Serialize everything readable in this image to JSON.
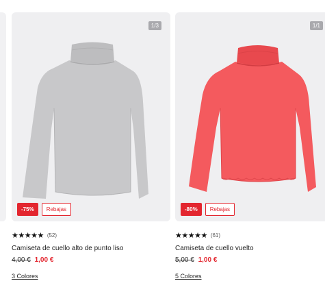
{
  "products": [
    {
      "counter": "1/3",
      "discount": "-75%",
      "sale_label": "Rebajas",
      "stars": "★★★★★",
      "reviews": "(52)",
      "title": "Camiseta de cuello alto de punto liso",
      "old_price": "4,00 €",
      "new_price": "1,00 €",
      "colors": "3 Colores",
      "garment_color": "#c8c8ca",
      "garment_shade": "#b4b4b6"
    },
    {
      "counter": "1/1",
      "discount": "-80%",
      "sale_label": "Rebajas",
      "stars": "★★★★★",
      "reviews": "(61)",
      "title": "Camiseta de cuello vuelto",
      "old_price": "5,00 €",
      "new_price": "1,00 €",
      "colors": "5 Colores",
      "garment_color": "#f45a5e",
      "garment_shade": "#e0474c"
    }
  ],
  "colors": {
    "sale_red": "#e3262f",
    "card_bg": "#efeff1"
  }
}
